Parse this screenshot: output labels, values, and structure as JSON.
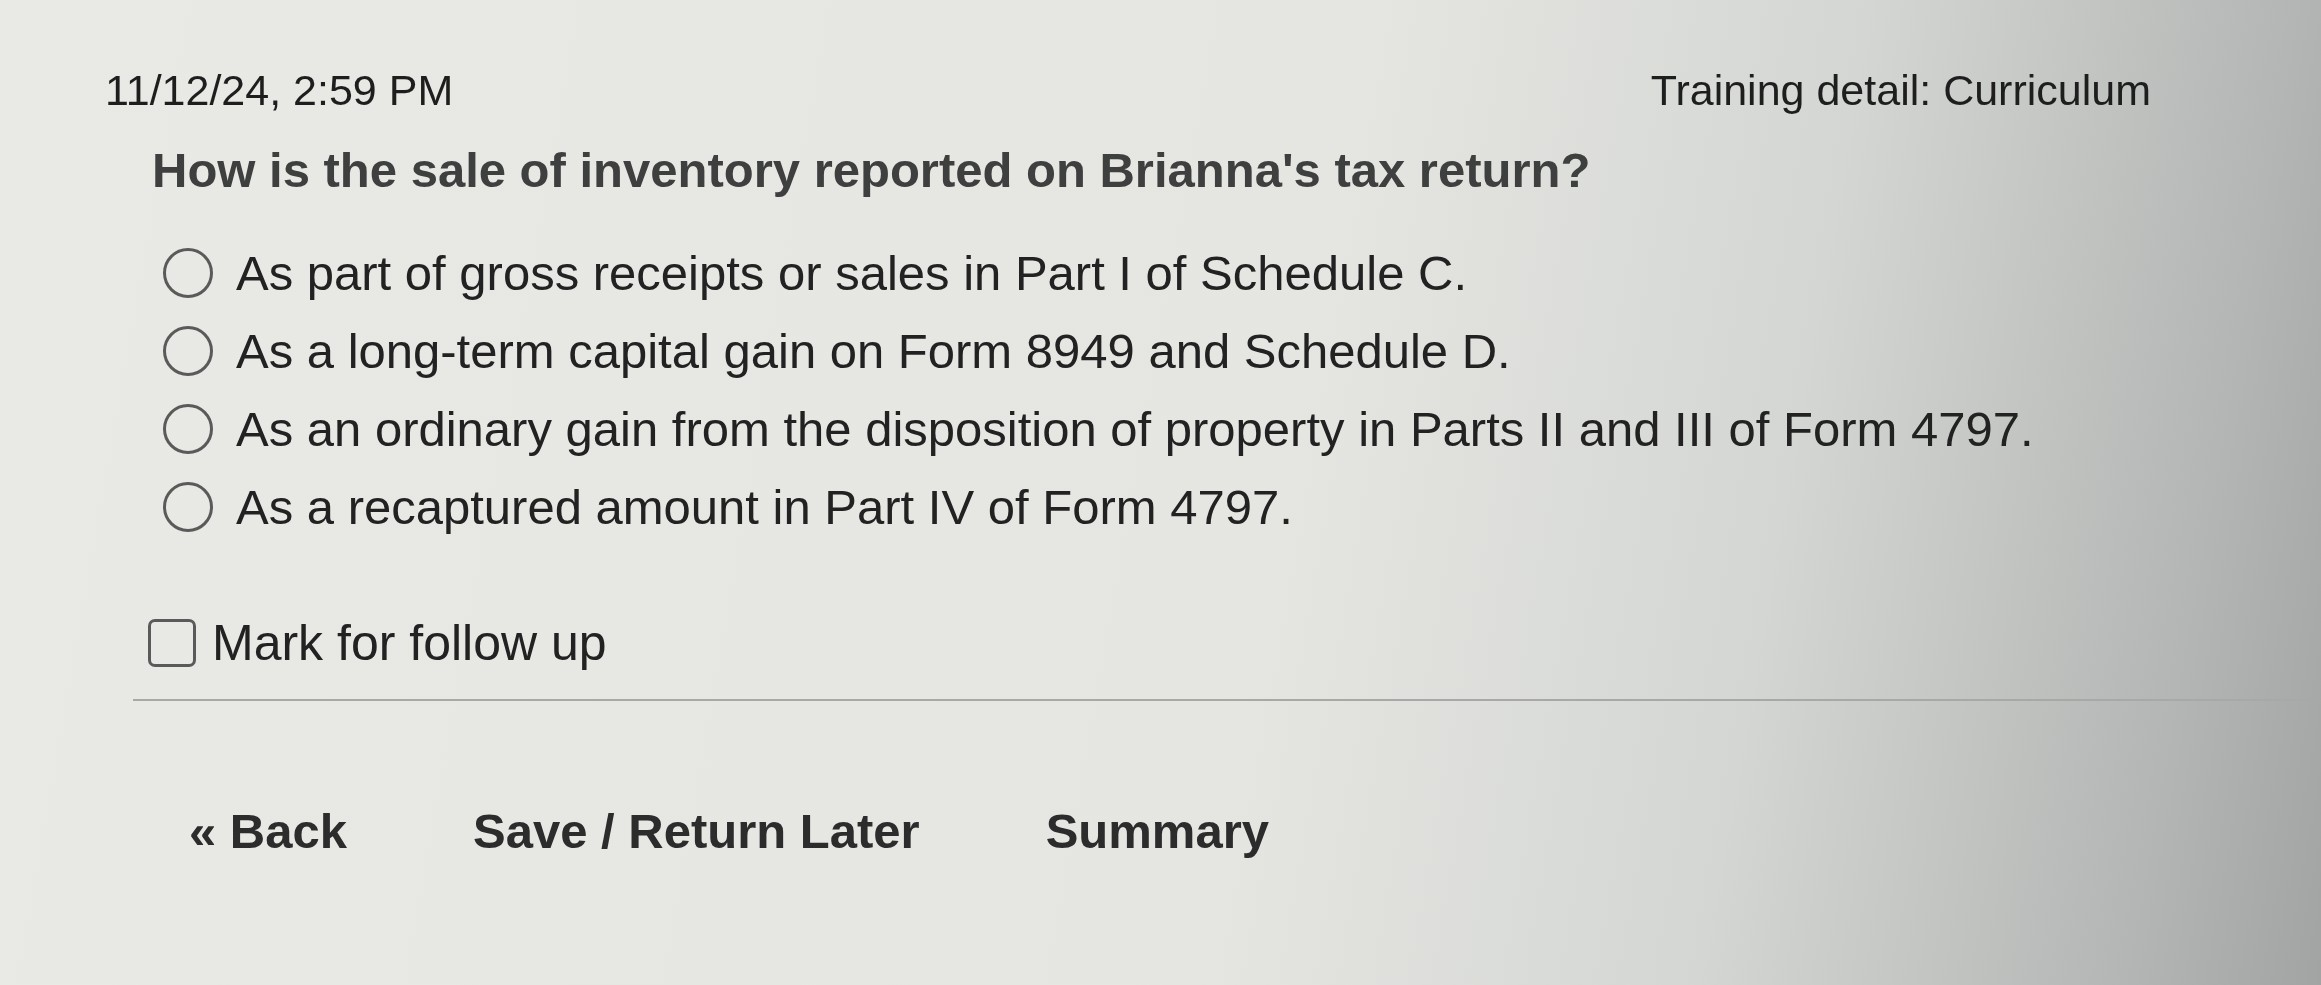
{
  "header": {
    "timestamp": "11/12/24, 2:59 PM",
    "page_title": "Training detail: Curriculum"
  },
  "question": {
    "text": "How is the sale of inventory reported on Brianna's tax return?",
    "options": [
      {
        "label": "As part of gross receipts or sales in Part I of Schedule C.",
        "selected": false
      },
      {
        "label": "As a long-term capital gain on Form 8949 and Schedule D.",
        "selected": false
      },
      {
        "label": "As an ordinary gain from the disposition of property in Parts II and III of Form 4797.",
        "selected": false
      },
      {
        "label": "As a recaptured amount in Part IV of Form 4797.",
        "selected": false
      }
    ]
  },
  "follow_up": {
    "label": "Mark for follow up",
    "checked": false
  },
  "navigation": [
    {
      "label": "« Back"
    },
    {
      "label": "Save / Return Later"
    },
    {
      "label": "Summary"
    }
  ]
}
